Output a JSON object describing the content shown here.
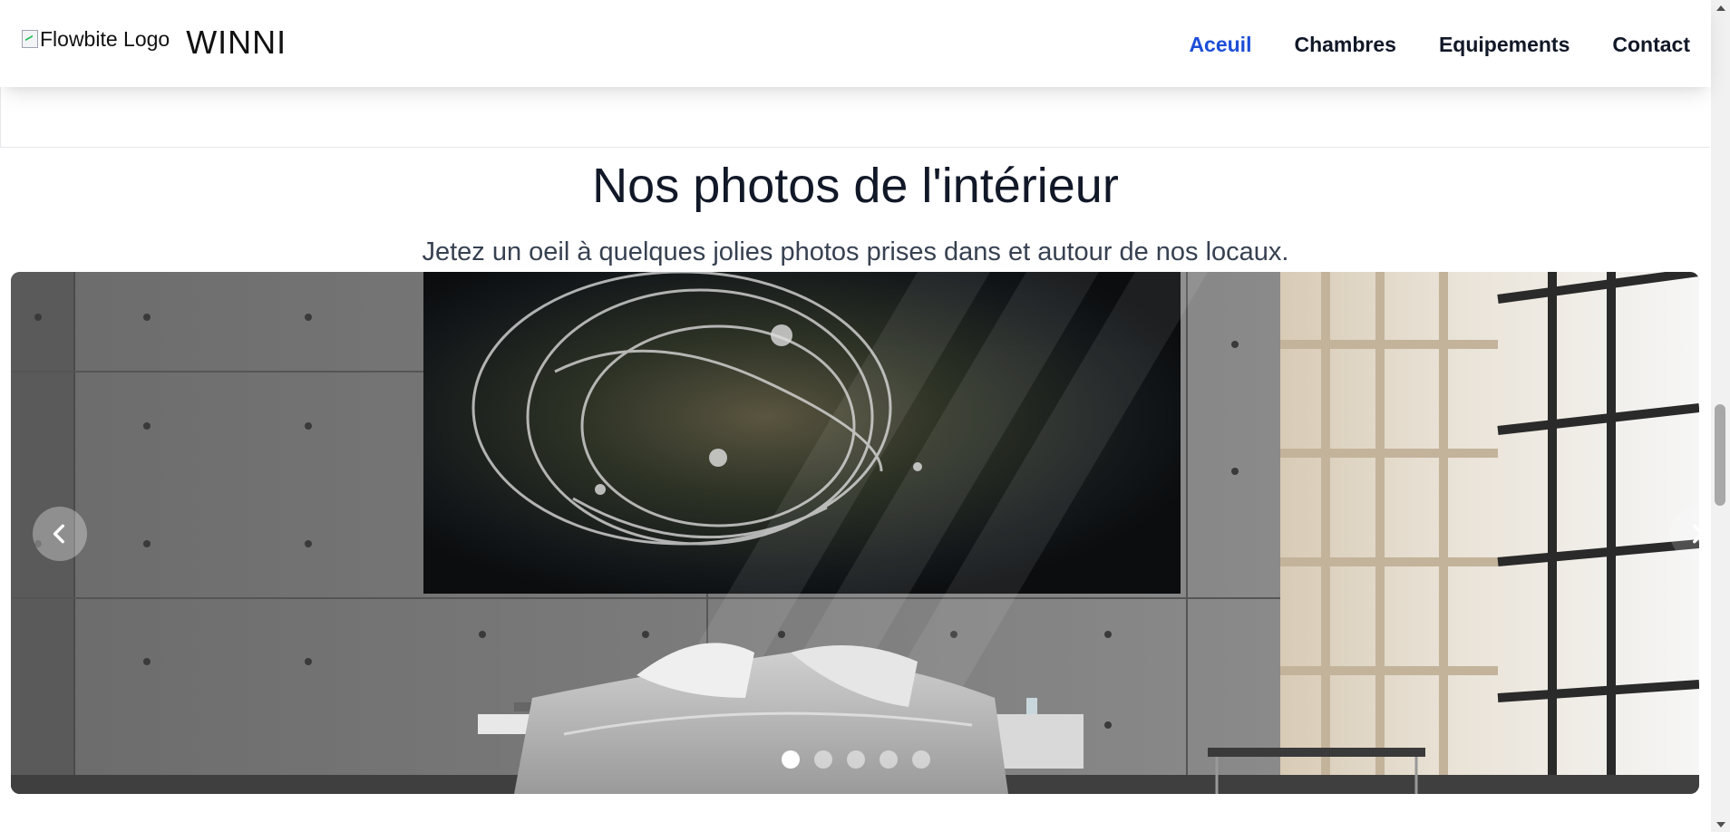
{
  "navbar": {
    "logo_alt": "Flowbite Logo",
    "brand": "WINNI",
    "links": [
      {
        "label": "Aceuil",
        "active": true
      },
      {
        "label": "Chambres",
        "active": false
      },
      {
        "label": "Equipements",
        "active": false
      },
      {
        "label": "Contact",
        "active": false
      }
    ],
    "active_color": "#1d4ed8"
  },
  "section": {
    "title": "Nos photos de l'intérieur",
    "subtitle": "Jetez un oeil à quelques jolies photos prises dans et autour de nos locaux."
  },
  "carousel": {
    "slide_count": 5,
    "active_index": 0,
    "prev_icon": "chevron-left-icon",
    "next_icon": "chevron-right-icon"
  }
}
